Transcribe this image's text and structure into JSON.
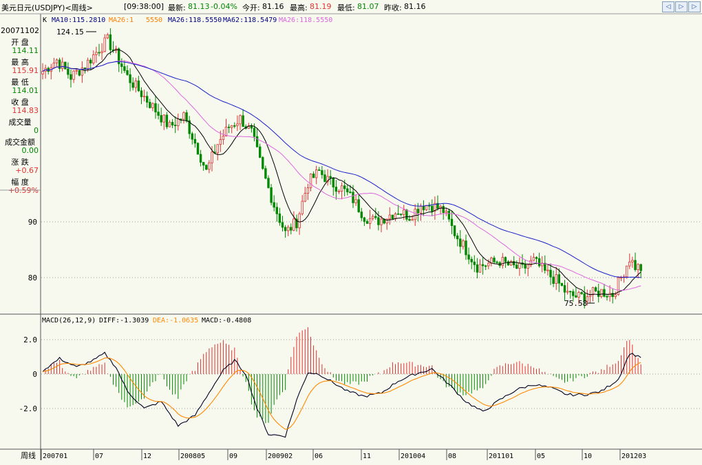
{
  "header": {
    "symbol": "美元日元(USDJPY)<周线>",
    "time": "[09:38:00]",
    "latest_label": "最新:",
    "latest": "81.13",
    "change": "-0.04%",
    "open_label": "今开:",
    "open": "81.16",
    "high_label": "最高:",
    "high": "81.19",
    "low_label": "最低:",
    "low": "81.07",
    "prev_label": "昨收:",
    "prev": "81.16",
    "nav_left": "◁",
    "nav_right": "▷",
    "nav_next": "▷"
  },
  "price_panel": {
    "k_label": "K",
    "ma_legend": [
      {
        "text": "MA10:115.2810",
        "color": "#000080"
      },
      {
        "text": "MA26:1",
        "color": "#ff8000"
      },
      {
        "text": "5550",
        "color": "#ff8000"
      },
      {
        "text": "MA26:118.5550",
        "color": "#000080"
      },
      {
        "text": "MA62:118.5479",
        "color": "#000080"
      },
      {
        "text": "MA26:118.5550",
        "color": "#dd66dd"
      }
    ],
    "max_label": "124.15",
    "min_label": "75.58",
    "y_labels": [
      "90",
      "80"
    ],
    "y_values": [
      90,
      80
    ]
  },
  "info": {
    "date": "20071102",
    "open_label": "开  盘",
    "open": "114.11",
    "high_label": "最  高",
    "high": "115.91",
    "low_label": "最  低",
    "low": "114.01",
    "close_label": "收  盘",
    "close": "114.83",
    "volume_label": "成交量",
    "volume": "0",
    "amount_label": "成交金额",
    "amount": "0.00",
    "change_label": "涨  跌",
    "change": "+0.67",
    "range_label": "幅  度",
    "range": "+0.59%"
  },
  "macd_panel": {
    "title": "MACD(26,12,9)",
    "diff": "DIFF:-1.3039",
    "dea": "DEA:-1.0635",
    "macd": "MACD:-0.4808",
    "y_labels": [
      "2.0",
      "0",
      "-2.0"
    ],
    "y_values": [
      2,
      0,
      -2
    ]
  },
  "x_axis": {
    "period_label": "周线",
    "labels": [
      "200701",
      "07",
      "12",
      "200805",
      "09",
      "200902",
      "06",
      "11",
      "201004",
      "08",
      "201101",
      "05",
      "10",
      "201203"
    ]
  },
  "colors": {
    "up": "#e03030",
    "down": "#008800",
    "ma_black": "#000000",
    "ma_blue": "#1a20c8",
    "ma_pink": "#dd66dd",
    "diff": "#000020",
    "dea": "#ff8800",
    "grid": "#999999"
  },
  "chart_data": {
    "type": "candlestick",
    "price_anchors": [
      [
        0,
        117
      ],
      [
        5,
        119
      ],
      [
        10,
        116
      ],
      [
        15,
        118
      ],
      [
        20,
        121
      ],
      [
        23,
        122.5
      ],
      [
        26,
        120
      ],
      [
        30,
        116
      ],
      [
        35,
        113
      ],
      [
        40,
        110
      ],
      [
        45,
        107
      ],
      [
        50,
        109
      ],
      [
        55,
        103
      ],
      [
        58,
        99
      ],
      [
        62,
        104
      ],
      [
        66,
        107
      ],
      [
        70,
        108.5
      ],
      [
        74,
        106
      ],
      [
        78,
        99
      ],
      [
        82,
        93
      ],
      [
        86,
        88
      ],
      [
        90,
        90
      ],
      [
        94,
        97
      ],
      [
        98,
        99
      ],
      [
        102,
        97
      ],
      [
        106,
        96
      ],
      [
        110,
        94
      ],
      [
        114,
        91
      ],
      [
        118,
        90
      ],
      [
        122,
        91
      ],
      [
        126,
        92
      ],
      [
        130,
        91
      ],
      [
        134,
        93
      ],
      [
        138,
        93
      ],
      [
        142,
        92
      ],
      [
        146,
        88
      ],
      [
        150,
        85
      ],
      [
        154,
        82
      ],
      [
        158,
        82.5
      ],
      [
        162,
        83
      ],
      [
        166,
        82
      ],
      [
        170,
        81.5
      ],
      [
        174,
        83
      ],
      [
        178,
        81
      ],
      [
        182,
        79.5
      ],
      [
        186,
        77
      ],
      [
        190,
        76.5
      ],
      [
        194,
        77
      ],
      [
        198,
        77.5
      ],
      [
        202,
        77
      ],
      [
        205,
        80
      ],
      [
        208,
        83.5
      ],
      [
        210,
        82
      ]
    ],
    "macd_diff_anchors": [
      [
        0,
        0.2
      ],
      [
        6,
        0.9
      ],
      [
        12,
        0.4
      ],
      [
        18,
        0.8
      ],
      [
        22,
        1.2
      ],
      [
        26,
        0.4
      ],
      [
        30,
        -1.0
      ],
      [
        36,
        -2.0
      ],
      [
        42,
        -1.6
      ],
      [
        48,
        -3.0
      ],
      [
        54,
        -2.4
      ],
      [
        60,
        -0.8
      ],
      [
        64,
        0.2
      ],
      [
        68,
        0.8
      ],
      [
        72,
        0
      ],
      [
        76,
        -2.0
      ],
      [
        80,
        -3.5
      ],
      [
        86,
        -3.6
      ],
      [
        90,
        -1.5
      ],
      [
        94,
        0.1
      ],
      [
        98,
        0
      ],
      [
        102,
        -0.4
      ],
      [
        108,
        -1.0
      ],
      [
        114,
        -1.3
      ],
      [
        120,
        -1.1
      ],
      [
        126,
        -0.4
      ],
      [
        132,
        0.0
      ],
      [
        138,
        0.3
      ],
      [
        144,
        -0.6
      ],
      [
        150,
        -1.6
      ],
      [
        156,
        -2.2
      ],
      [
        162,
        -1.5
      ],
      [
        168,
        -0.9
      ],
      [
        174,
        -0.6
      ],
      [
        180,
        -0.8
      ],
      [
        186,
        -1.2
      ],
      [
        192,
        -1.2
      ],
      [
        198,
        -1.0
      ],
      [
        204,
        -0.3
      ],
      [
        208,
        1.2
      ],
      [
        212,
        1.0
      ]
    ]
  }
}
